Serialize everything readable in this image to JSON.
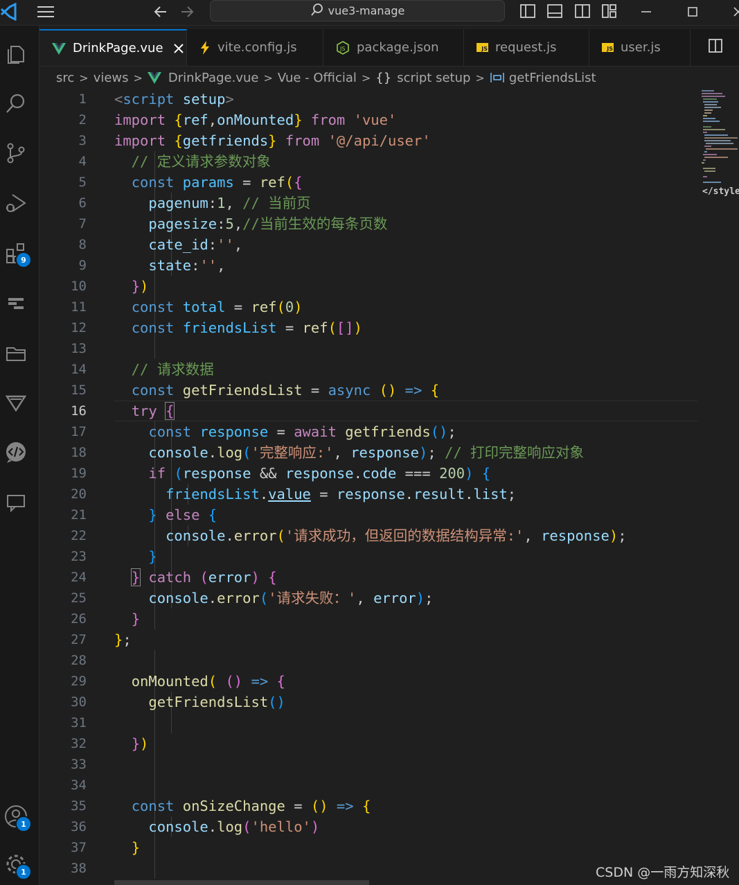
{
  "titlebar": {
    "search_text": "vue3-manage"
  },
  "activity_bar": {
    "extensions_badge": "9",
    "accounts_badge": "1",
    "settings_badge": "1"
  },
  "tabs": [
    {
      "label": "DrinkPage.vue",
      "icon": "vue-icon",
      "active": true
    },
    {
      "label": "vite.config.js",
      "icon": "vite-bolt-icon",
      "active": false
    },
    {
      "label": "package.json",
      "icon": "nodejs-icon",
      "active": false
    },
    {
      "label": "request.js",
      "icon": "js-file-icon",
      "active": false
    },
    {
      "label": "user.js",
      "icon": "js-file-icon",
      "active": false
    }
  ],
  "breadcrumb": {
    "seg1": "src",
    "seg2": "views",
    "seg3": "DrinkPage.vue",
    "seg4": "Vue - Official",
    "seg5": "script setup",
    "seg6": "getFriendsList"
  },
  "editor": {
    "current_line": 16,
    "line_numbers": [
      "1",
      "2",
      "3",
      "4",
      "5",
      "6",
      "7",
      "8",
      "9",
      "10",
      "11",
      "12",
      "13",
      "14",
      "15",
      "16",
      "17",
      "18",
      "19",
      "20",
      "21",
      "22",
      "23",
      "24",
      "25",
      "26",
      "27",
      "28",
      "29",
      "30",
      "31",
      "32",
      "33",
      "34",
      "35",
      "36",
      "37",
      "38"
    ],
    "lines": [
      "<script setup>",
      "import {ref,onMounted} from 'vue'",
      "import {getfriends} from '@/api/user'",
      "  // 定义请求参数对象",
      "  const params = ref({",
      "    pagenum:1, // 当前页",
      "    pagesize:5,//当前生效的每条页数",
      "    cate_id:'',",
      "    state:'',",
      "  })",
      "  const total = ref(0)",
      "  const friendsList = ref([])",
      "",
      "  // 请求数据",
      "  const getFriendsList = async () => {",
      "  try {",
      "    const response = await getfriends();",
      "    console.log('完整响应:', response); // 打印完整响应对象",
      "    if (response && response.code === 200) {",
      "      friendsList.value = response.result.list;",
      "    } else {",
      "      console.error('请求成功，但返回的数据结构异常:', response);",
      "    }",
      "  } catch (error) {",
      "    console.error('请求失败：', error);",
      "  }",
      "};",
      "",
      "  onMounted( () => {",
      "    getFriendsList()",
      "",
      "  })",
      "",
      "",
      "  const onSizeChange = () => {",
      "    console.log('hello')",
      "  }",
      ""
    ]
  },
  "minimap": {
    "visible_text": "</style>"
  },
  "watermark": "CSDN @一雨方知深秋",
  "colors": {
    "accent": "#0078d4",
    "keyword": "#c586c0",
    "declaration": "#569cd6",
    "function": "#dcdcaa",
    "variable": "#9cdcfe",
    "string": "#ce9178",
    "comment": "#6a9955",
    "number": "#b5cea8"
  }
}
